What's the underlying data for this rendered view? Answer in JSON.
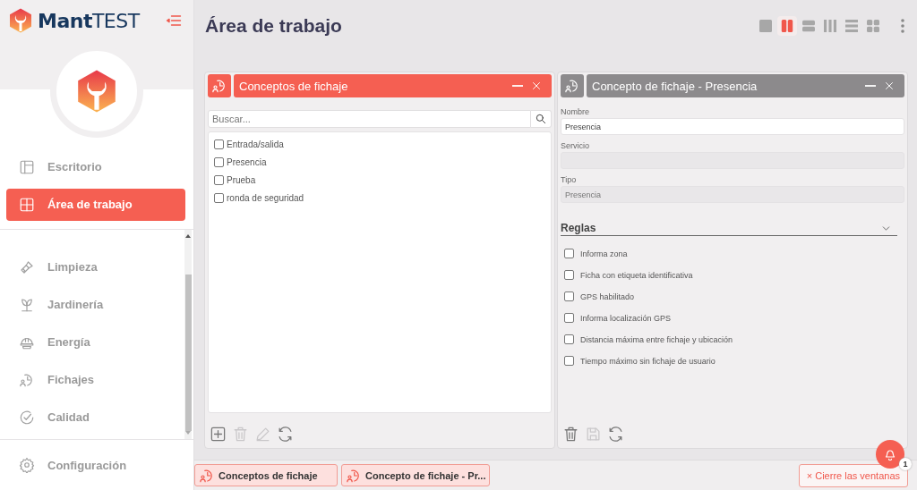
{
  "brand": {
    "name": "**Mant**TEST"
  },
  "sidebar": {
    "items": [
      {
        "label": "Escritorio",
        "selected": false
      },
      {
        "label": "Área de trabajo",
        "selected": true
      }
    ],
    "scroll_items": [
      {
        "label": "Limpieza",
        "selected": false
      },
      {
        "label": "Jardinería",
        "selected": false
      },
      {
        "label": "Energía",
        "selected": false
      },
      {
        "label": "Fichajes",
        "selected": false
      },
      {
        "label": "Calidad",
        "selected": false
      }
    ],
    "footer_item": {
      "label": "Configuración"
    }
  },
  "page": {
    "title": "Área de trabajo"
  },
  "layout_buttons": [
    {
      "selected": false
    },
    {
      "selected": true
    },
    {
      "selected": false
    },
    {
      "selected": false
    },
    {
      "selected": false
    },
    {
      "selected": false
    }
  ],
  "windows": [
    {
      "title": "Conceptos de fichaje",
      "active": true,
      "search": {
        "placeholder": "Buscar..."
      },
      "items": [
        {
          "label": "Entrada/salida",
          "checked": false
        },
        {
          "label": "Presencia",
          "checked": false
        },
        {
          "label": "Prueba",
          "checked": false
        },
        {
          "label": "ronda de seguridad",
          "checked": false
        }
      ],
      "tools": [
        {
          "kind": "add",
          "disabled": false
        },
        {
          "kind": "delete",
          "disabled": true
        },
        {
          "kind": "edit",
          "disabled": true
        },
        {
          "kind": "refresh",
          "disabled": false
        }
      ]
    },
    {
      "title": "Concepto de fichaje - Presencia",
      "active": false,
      "fields": [
        {
          "label": "Nombre",
          "value": "Presencia",
          "disabled": false
        },
        {
          "label": "Servicio",
          "disabled": true
        },
        {
          "label": "Tipo",
          "value": "Presencia",
          "disabled": true
        }
      ],
      "section": {
        "title": "Reglas",
        "expanded": true
      },
      "rules": [
        {
          "label": "Informa zona",
          "checked": false
        },
        {
          "label": "Ficha con etiqueta identificativa",
          "checked": false
        },
        {
          "label": "GPS habilitado",
          "checked": false
        },
        {
          "label": "Informa localización GPS",
          "checked": false
        },
        {
          "label": "Distancia máxima entre fichaje y ubicación",
          "checked": false
        },
        {
          "label": "Tiempo máximo sin fichaje de usuario",
          "checked": false
        }
      ],
      "tools": [
        {
          "kind": "delete",
          "disabled": false
        },
        {
          "kind": "save",
          "disabled": true
        },
        {
          "kind": "refresh",
          "disabled": false
        }
      ]
    }
  ],
  "taskbar": {
    "tabs": [
      {
        "label": "Conceptos de fichaje"
      },
      {
        "label": "Concepto de fichaje - Pr..."
      }
    ],
    "close_all": {
      "label": "× Cierre las ventanas"
    }
  },
  "notifications": {
    "count": "1"
  }
}
